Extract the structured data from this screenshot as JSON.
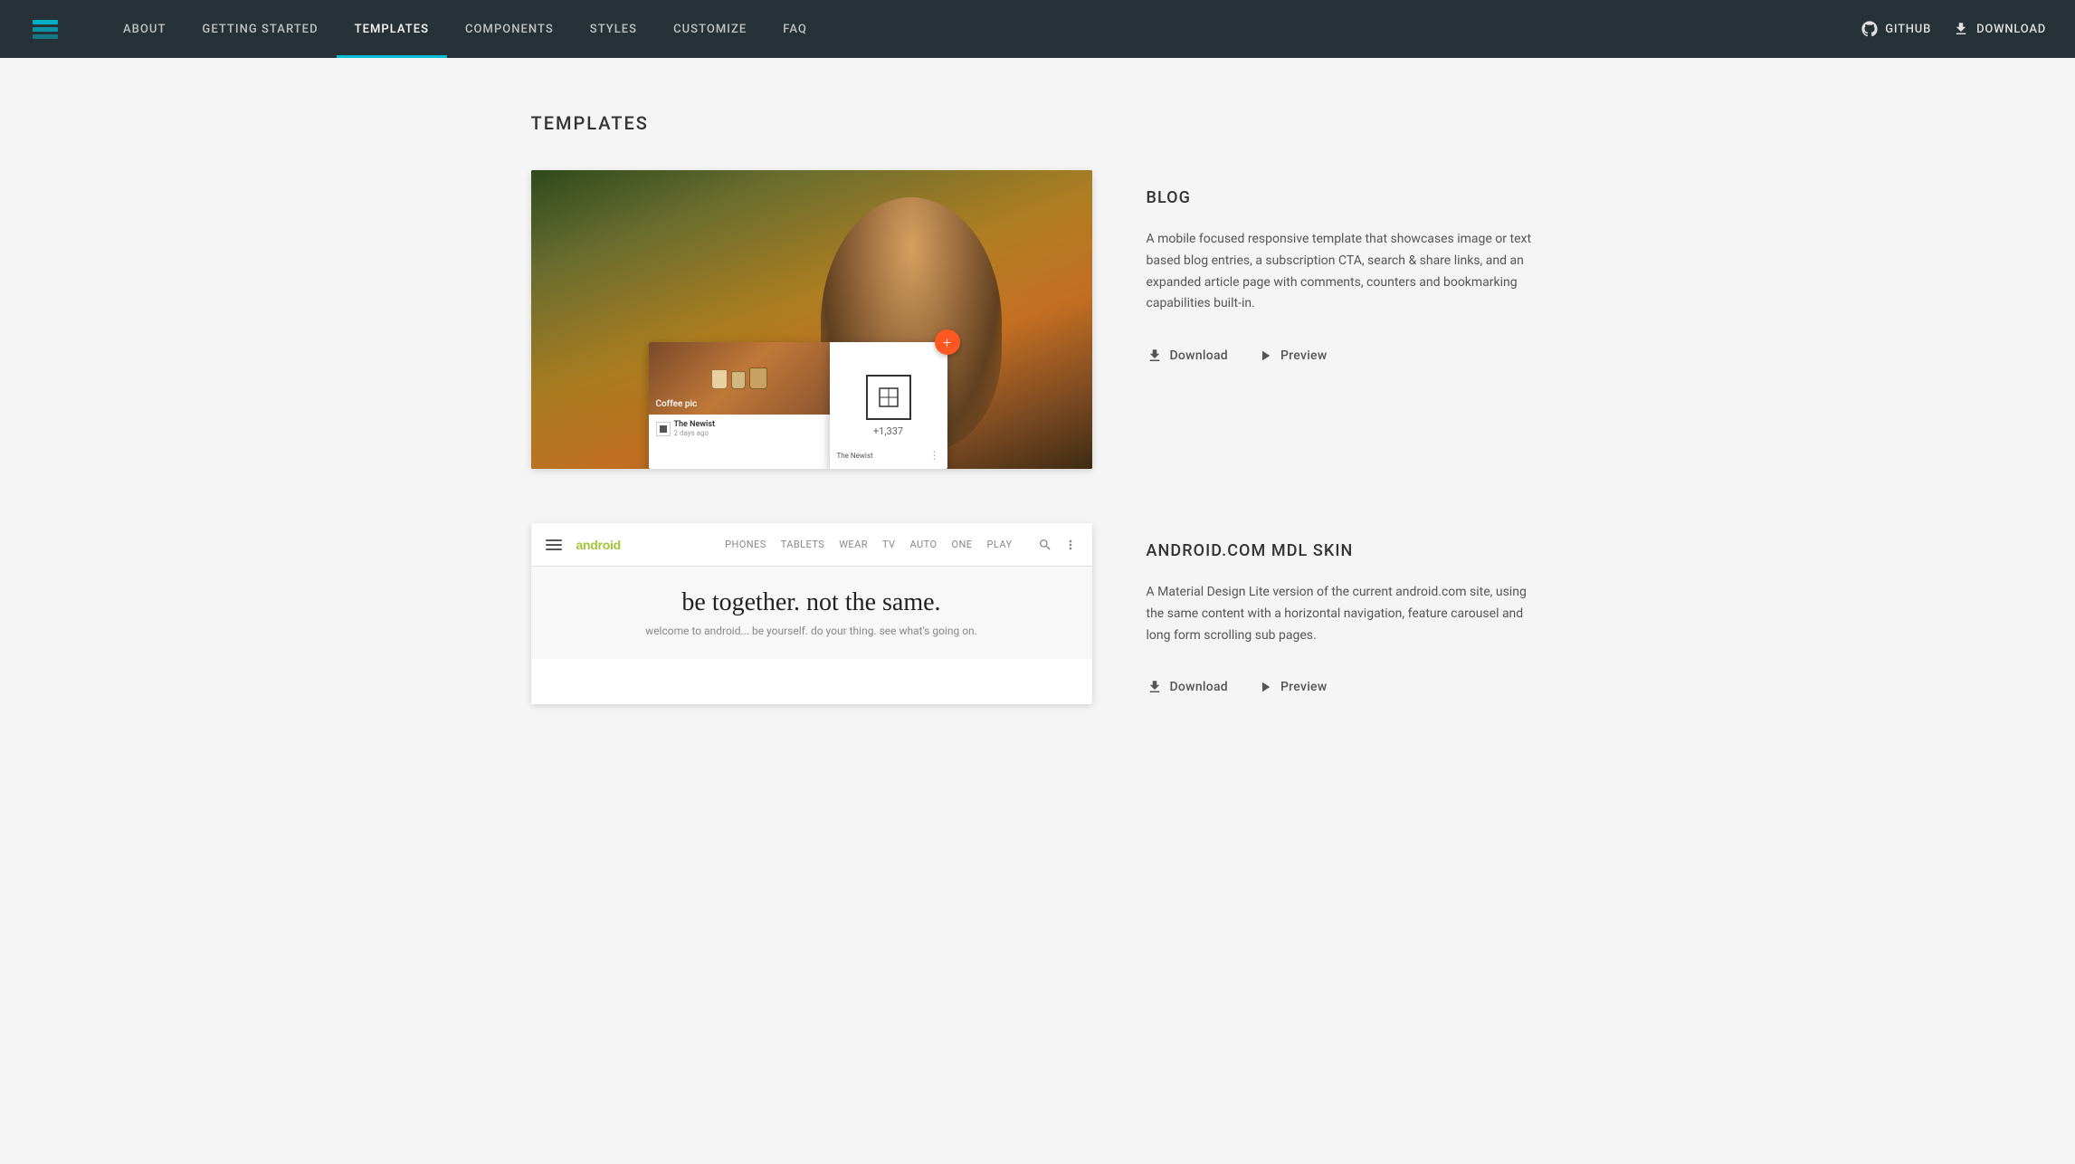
{
  "header": {
    "logo_alt": "MDL Logo",
    "nav_items": [
      {
        "label": "ABOUT",
        "active": false,
        "id": "about"
      },
      {
        "label": "GETTING STARTED",
        "active": false,
        "id": "getting-started"
      },
      {
        "label": "TEMPLATES",
        "active": true,
        "id": "templates"
      },
      {
        "label": "COMPONENTS",
        "active": false,
        "id": "components"
      },
      {
        "label": "STYLES",
        "active": false,
        "id": "styles"
      },
      {
        "label": "CUSTOMIZE",
        "active": false,
        "id": "customize"
      },
      {
        "label": "FAQ",
        "active": false,
        "id": "faq"
      }
    ],
    "github_label": "GitHub",
    "download_label": "Download"
  },
  "main": {
    "page_title": "TEMPLATES",
    "templates": [
      {
        "id": "blog",
        "name": "BLOG",
        "description": "A mobile focused responsive template that showcases image or text based blog entries, a subscription CTA, search & share links, and an expanded article page with comments, counters and bookmarking capabilities built-in.",
        "download_label": "Download",
        "preview_label": "Preview",
        "mobile_card": {
          "image_label": "Coffee pic",
          "post_title": "The Newist",
          "post_date": "2 days ago",
          "count": "+1,337",
          "fab_icon": "+"
        }
      },
      {
        "id": "android",
        "name": "ANDROID.COM MDL SKIN",
        "description": "A Material Design Lite version of the current android.com site, using the same content with a horizontal navigation, feature carousel and long form scrolling sub pages.",
        "download_label": "Download",
        "preview_label": "Preview",
        "android_nav": {
          "links": [
            "PHONES",
            "TABLETS",
            "WEAR",
            "TV",
            "AUTO",
            "ONE",
            "PLAY"
          ]
        },
        "android_hero": {
          "headline": "be together. not the same.",
          "subtext": "welcome to android... be yourself. do your thing. see what's going on."
        }
      }
    ]
  }
}
